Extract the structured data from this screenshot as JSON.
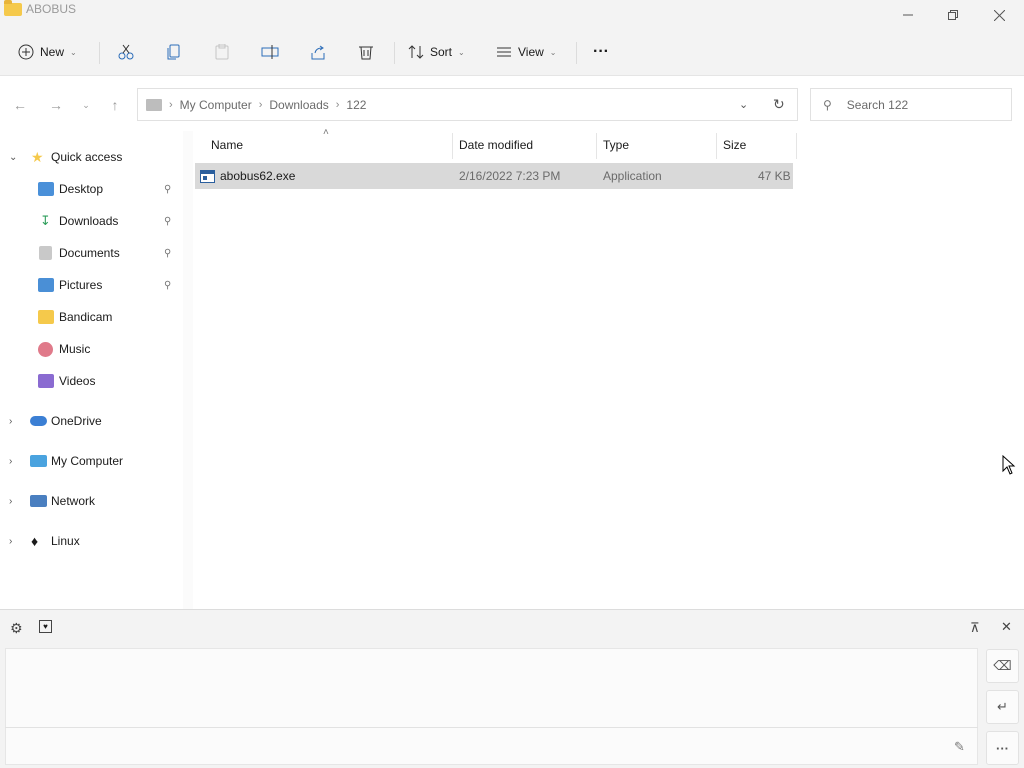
{
  "window": {
    "title": "ABOBUS",
    "minimize_icon": "minimize-icon",
    "restore_icon": "restore-icon",
    "close_icon": "close-icon"
  },
  "toolbar": {
    "new_label": "New",
    "sort_label": "Sort",
    "view_label": "View",
    "more_label": "···"
  },
  "address": {
    "crumbs": [
      "My Computer",
      "Downloads",
      "122"
    ],
    "search_placeholder": "Search 122"
  },
  "sidebar": {
    "quick_access": "Quick access",
    "items": [
      {
        "label": "Desktop",
        "pinned": true,
        "color": "#4a90d9"
      },
      {
        "label": "Downloads",
        "pinned": true,
        "color": "#2e9e5b"
      },
      {
        "label": "Documents",
        "pinned": true,
        "color": "#9a9a9a"
      },
      {
        "label": "Pictures",
        "pinned": true,
        "color": "#4a8fd6"
      },
      {
        "label": "Bandicam",
        "pinned": false,
        "color": "#f5c94b"
      },
      {
        "label": "Music",
        "pinned": false,
        "color": "#e07a8a"
      },
      {
        "label": "Videos",
        "pinned": false,
        "color": "#8a6bd1"
      }
    ],
    "roots": [
      {
        "label": "OneDrive",
        "color": "#3b7fd4"
      },
      {
        "label": "My Computer",
        "color": "#4aa3df"
      },
      {
        "label": "Network",
        "color": "#4a7fc0"
      },
      {
        "label": "Linux",
        "color": "#333333"
      }
    ]
  },
  "columns": {
    "name": "Name",
    "date": "Date modified",
    "type": "Type",
    "size": "Size"
  },
  "files": [
    {
      "name": "abobus62.exe",
      "date": "2/16/2022 7:23 PM",
      "type": "Application",
      "size": "47 KB"
    }
  ]
}
